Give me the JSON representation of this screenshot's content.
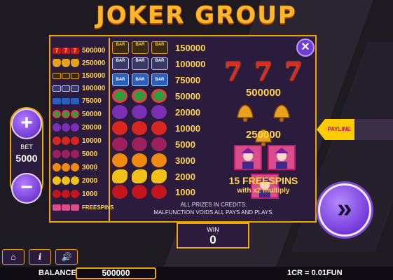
{
  "title": "JOKER GROUP",
  "close_glyph": "✕",
  "bet": {
    "label": "BET",
    "value": "5000",
    "plus": "+",
    "minus": "−"
  },
  "win": {
    "label": "WIN",
    "value": "0"
  },
  "spin_glyph": "»",
  "payline_label": "PAYLINE",
  "balance": {
    "label": "BALANCE",
    "value": "500000"
  },
  "credit_rate": "1CR = 0.01FUN",
  "bottom_icons": {
    "home": "⌂",
    "info": "i",
    "sound": "🔊"
  },
  "left_paytable": [
    {
      "symbol": "seven",
      "value": "500000"
    },
    {
      "symbol": "bell",
      "value": "250000"
    },
    {
      "symbol": "triple-bar",
      "value": "150000"
    },
    {
      "symbol": "double-bar",
      "value": "100000"
    },
    {
      "symbol": "bar",
      "value": "75000"
    },
    {
      "symbol": "watermelon",
      "value": "50000"
    },
    {
      "symbol": "grapes",
      "value": "20000"
    },
    {
      "symbol": "tomato",
      "value": "10000"
    },
    {
      "symbol": "plum",
      "value": "5000"
    },
    {
      "symbol": "orange",
      "value": "3000"
    },
    {
      "symbol": "lemon",
      "value": "2000"
    },
    {
      "symbol": "cherry",
      "value": "1000"
    },
    {
      "symbol": "joker",
      "value": "FREESPINS"
    }
  ],
  "mid_paytable": [
    {
      "symbol": "triple-bar",
      "value": "150000"
    },
    {
      "symbol": "double-bar",
      "value": "100000"
    },
    {
      "symbol": "bar",
      "value": "75000"
    },
    {
      "symbol": "watermelon",
      "value": "50000"
    },
    {
      "symbol": "grapes",
      "value": "20000"
    },
    {
      "symbol": "tomato",
      "value": "10000"
    },
    {
      "symbol": "plum",
      "value": "5000"
    },
    {
      "symbol": "orange",
      "value": "3000"
    },
    {
      "symbol": "lemon",
      "value": "2000"
    },
    {
      "symbol": "cherry",
      "value": "1000"
    }
  ],
  "right_paytable": {
    "seven_value": "500000",
    "bell_value": "250000",
    "freespins_line1": "15 FREESPINS",
    "freespins_line2": "with x2 multiply"
  },
  "notes": [
    "ALL PRIZES IN CREDITS.",
    "MALFUNCTION VOIDS ALL PAYS AND PLAYS."
  ],
  "bar_text": "BAR",
  "seven_glyph": "7",
  "colors": {
    "gold": "#f0a500",
    "panel": "#2b1b3d",
    "prize_text": "#ffd34a",
    "button_purple": "#6e3bd4",
    "seven_red": "#e8241c"
  }
}
